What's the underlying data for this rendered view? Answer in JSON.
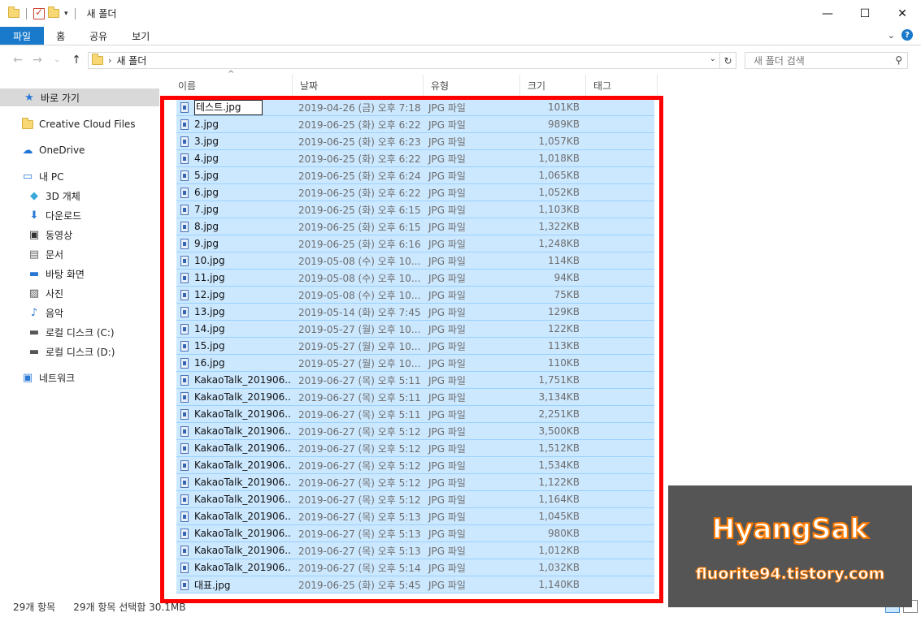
{
  "window": {
    "title": "새 폴더",
    "controls": {
      "minimize": "—",
      "maximize": "☐",
      "close": "✕"
    }
  },
  "ribbon": {
    "tabs": [
      {
        "label": "파일"
      },
      {
        "label": "홈"
      },
      {
        "label": "공유"
      },
      {
        "label": "보기"
      }
    ]
  },
  "address": {
    "path": "새 폴더",
    "search_placeholder": "새 폴더 검색"
  },
  "sidebar": {
    "items": [
      {
        "label": "바로 가기",
        "icon": "star-icon"
      },
      {
        "label": "Creative Cloud Files",
        "icon": "cc-folder-icon"
      },
      {
        "label": "OneDrive",
        "icon": "cloud-icon"
      },
      {
        "label": "내 PC",
        "icon": "pc-icon"
      },
      {
        "label": "3D 개체",
        "icon": "cube-icon"
      },
      {
        "label": "다운로드",
        "icon": "download-icon"
      },
      {
        "label": "동영상",
        "icon": "video-icon"
      },
      {
        "label": "문서",
        "icon": "document-icon"
      },
      {
        "label": "바탕 화면",
        "icon": "desktop-icon"
      },
      {
        "label": "사진",
        "icon": "picture-icon"
      },
      {
        "label": "음악",
        "icon": "music-icon"
      },
      {
        "label": "로컬 디스크 (C:)",
        "icon": "drive-c-icon"
      },
      {
        "label": "로컬 디스크 (D:)",
        "icon": "drive-d-icon"
      },
      {
        "label": "네트워크",
        "icon": "network-icon"
      }
    ]
  },
  "columns": {
    "name": "이름",
    "date": "날짜",
    "type": "유형",
    "size": "크기",
    "tags": "태그"
  },
  "files": [
    {
      "name": "테스트.jpg",
      "date": "2019-04-26 (금) 오후 7:18",
      "type": "JPG 파일",
      "size": "101KB"
    },
    {
      "name": "2.jpg",
      "date": "2019-06-25 (화) 오후 6:22",
      "type": "JPG 파일",
      "size": "989KB"
    },
    {
      "name": "3.jpg",
      "date": "2019-06-25 (화) 오후 6:23",
      "type": "JPG 파일",
      "size": "1,057KB"
    },
    {
      "name": "4.jpg",
      "date": "2019-06-25 (화) 오후 6:22",
      "type": "JPG 파일",
      "size": "1,018KB"
    },
    {
      "name": "5.jpg",
      "date": "2019-06-25 (화) 오후 6:24",
      "type": "JPG 파일",
      "size": "1,065KB"
    },
    {
      "name": "6.jpg",
      "date": "2019-06-25 (화) 오후 6:22",
      "type": "JPG 파일",
      "size": "1,052KB"
    },
    {
      "name": "7.jpg",
      "date": "2019-06-25 (화) 오후 6:15",
      "type": "JPG 파일",
      "size": "1,103KB"
    },
    {
      "name": "8.jpg",
      "date": "2019-06-25 (화) 오후 6:15",
      "type": "JPG 파일",
      "size": "1,322KB"
    },
    {
      "name": "9.jpg",
      "date": "2019-06-25 (화) 오후 6:16",
      "type": "JPG 파일",
      "size": "1,248KB"
    },
    {
      "name": "10.jpg",
      "date": "2019-05-08 (수) 오후 10...",
      "type": "JPG 파일",
      "size": "114KB"
    },
    {
      "name": "11.jpg",
      "date": "2019-05-08 (수) 오후 10...",
      "type": "JPG 파일",
      "size": "94KB"
    },
    {
      "name": "12.jpg",
      "date": "2019-05-08 (수) 오후 10...",
      "type": "JPG 파일",
      "size": "75KB"
    },
    {
      "name": "13.jpg",
      "date": "2019-05-14 (화) 오후 7:45",
      "type": "JPG 파일",
      "size": "129KB"
    },
    {
      "name": "14.jpg",
      "date": "2019-05-27 (월) 오후 10...",
      "type": "JPG 파일",
      "size": "122KB"
    },
    {
      "name": "15.jpg",
      "date": "2019-05-27 (월) 오후 10...",
      "type": "JPG 파일",
      "size": "113KB"
    },
    {
      "name": "16.jpg",
      "date": "2019-05-27 (월) 오후 10...",
      "type": "JPG 파일",
      "size": "110KB"
    },
    {
      "name": "KakaoTalk_201906...",
      "date": "2019-06-27 (목) 오후 5:11",
      "type": "JPG 파일",
      "size": "1,751KB"
    },
    {
      "name": "KakaoTalk_201906...",
      "date": "2019-06-27 (목) 오후 5:11",
      "type": "JPG 파일",
      "size": "3,134KB"
    },
    {
      "name": "KakaoTalk_201906...",
      "date": "2019-06-27 (목) 오후 5:11",
      "type": "JPG 파일",
      "size": "2,251KB"
    },
    {
      "name": "KakaoTalk_201906...",
      "date": "2019-06-27 (목) 오후 5:12",
      "type": "JPG 파일",
      "size": "3,500KB"
    },
    {
      "name": "KakaoTalk_201906...",
      "date": "2019-06-27 (목) 오후 5:12",
      "type": "JPG 파일",
      "size": "1,512KB"
    },
    {
      "name": "KakaoTalk_201906...",
      "date": "2019-06-27 (목) 오후 5:12",
      "type": "JPG 파일",
      "size": "1,534KB"
    },
    {
      "name": "KakaoTalk_201906...",
      "date": "2019-06-27 (목) 오후 5:12",
      "type": "JPG 파일",
      "size": "1,122KB"
    },
    {
      "name": "KakaoTalk_201906...",
      "date": "2019-06-27 (목) 오후 5:12",
      "type": "JPG 파일",
      "size": "1,164KB"
    },
    {
      "name": "KakaoTalk_201906...",
      "date": "2019-06-27 (목) 오후 5:13",
      "type": "JPG 파일",
      "size": "1,045KB"
    },
    {
      "name": "KakaoTalk_201906...",
      "date": "2019-06-27 (목) 오후 5:13",
      "type": "JPG 파일",
      "size": "980KB"
    },
    {
      "name": "KakaoTalk_201906...",
      "date": "2019-06-27 (목) 오후 5:13",
      "type": "JPG 파일",
      "size": "1,012KB"
    },
    {
      "name": "KakaoTalk_201906...",
      "date": "2019-06-27 (목) 오후 5:14",
      "type": "JPG 파일",
      "size": "1,032KB"
    },
    {
      "name": "대표.jpg",
      "date": "2019-06-25 (화) 오후 5:45",
      "type": "JPG 파일",
      "size": "1,140KB"
    }
  ],
  "status": {
    "count": "29개 항목",
    "selected": "29개 항목 선택함 30.1MB"
  },
  "watermark": {
    "title": "HyangSak",
    "url": "fluorite94.tistory.com"
  },
  "colors": {
    "selection": "#cce8ff",
    "file_tab": "#1979ca",
    "highlight_frame": "#ff0000",
    "watermark_stroke": "#ff7b00"
  }
}
